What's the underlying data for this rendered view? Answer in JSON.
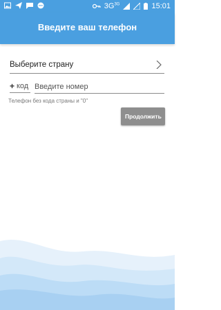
{
  "status_bar": {
    "network": "3G",
    "network_sup": "3G",
    "time": "15:01",
    "left_icons": [
      "image-icon",
      "paper-plane-icon",
      "chat-icon",
      "messenger-icon"
    ],
    "right_icons": [
      "key-icon",
      "signal-icon",
      "signal-icon-2",
      "battery-icon"
    ]
  },
  "header": {
    "title": "Введите ваш телефон"
  },
  "form": {
    "country_label": "Выберите страну",
    "plus": "+",
    "code_placeholder": "код",
    "phone_placeholder": "Введите номер",
    "hint": "Телефон без кода страны и \"0\"",
    "continue_label": "Продолжить"
  },
  "colors": {
    "accent": "#4a9fe0",
    "button": "#8e8e8e"
  }
}
